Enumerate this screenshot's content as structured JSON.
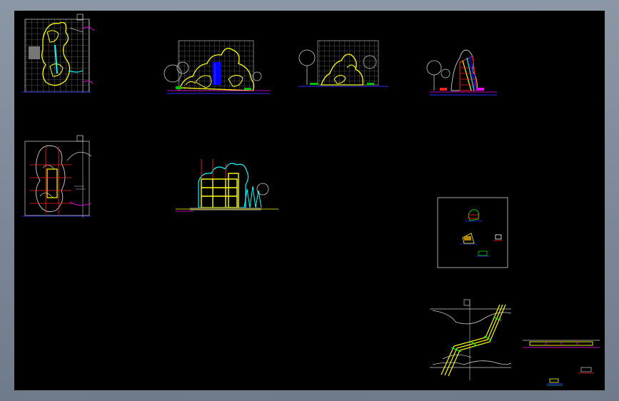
{
  "app": {
    "title": ""
  },
  "colors": {
    "background": "#000000",
    "frame": "#7f8a99",
    "rock_outline": "#ffff00",
    "grid": "#9a9a9a",
    "water": "#00ffff",
    "waterfall": "#0000ff",
    "plant": "#dddddd",
    "ground": "#2b2bff",
    "accent_red": "#ff2020",
    "accent_magenta": "#ff00ff",
    "accent_green": "#00c000"
  },
  "drawings": [
    {
      "id": "plan-grid",
      "icon": "rockery-plan"
    },
    {
      "id": "front-elevation",
      "icon": "rockery-elevation"
    },
    {
      "id": "side-elevation",
      "icon": "rockery-elevation"
    },
    {
      "id": "section-waterfall",
      "icon": "rockery-section"
    },
    {
      "id": "plan-structure",
      "icon": "rockery-plan"
    },
    {
      "id": "structure-elevation",
      "icon": "frame-elevation"
    },
    {
      "id": "detail-sheet",
      "icon": "detail-sheet"
    },
    {
      "id": "path-plan",
      "icon": "path-plan"
    },
    {
      "id": "path-section",
      "icon": "path-section"
    }
  ]
}
